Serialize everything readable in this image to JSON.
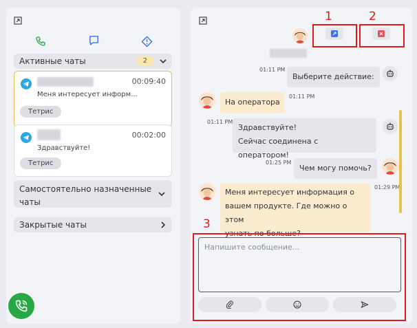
{
  "left_panel": {
    "tabs": [
      {
        "icon": "phone-icon",
        "active": false
      },
      {
        "icon": "chat-icon",
        "active": true
      },
      {
        "icon": "alert-icon",
        "active": false
      }
    ],
    "sections": {
      "active": {
        "label": "Активные чаты",
        "count": "2"
      },
      "self_assigned": {
        "label_line1": "Самостоятельно назначенные",
        "label_line2": "чаты"
      },
      "closed": {
        "label": "Закрытые чаты"
      }
    },
    "chats": [
      {
        "time": "00:09:40",
        "preview": "Меня интересует информ...",
        "tag": "Тетрис"
      },
      {
        "time": "00:02:00",
        "preview": "Здравствуйте!",
        "tag": "Тетрис"
      }
    ]
  },
  "conversation": {
    "messages": [
      {
        "text": "Выберите действие:",
        "time": "01:11 PM"
      },
      {
        "text": "На оператора",
        "time": "01:11 PM"
      },
      {
        "line1": "Здравствуйте!",
        "line2": "Сейчас соединена с оператором!",
        "time": "01:11 PM"
      },
      {
        "text": "Чем могу помочь?",
        "time": "01:25 PM"
      },
      {
        "line1": "Меня интересует информация о",
        "line2": "вашем продукте. Где можно о этом",
        "line3": "узнать по больше?",
        "time": "01:29 PM"
      }
    ],
    "composer_placeholder": "Напишите сообщение..."
  },
  "annotations": {
    "n1": "1",
    "n2": "2",
    "n3": "3"
  },
  "colors": {
    "accent": "#e7c14c",
    "telegram": "#2ea6e0",
    "call": "#27a844",
    "annotation": "#e01b1b"
  }
}
